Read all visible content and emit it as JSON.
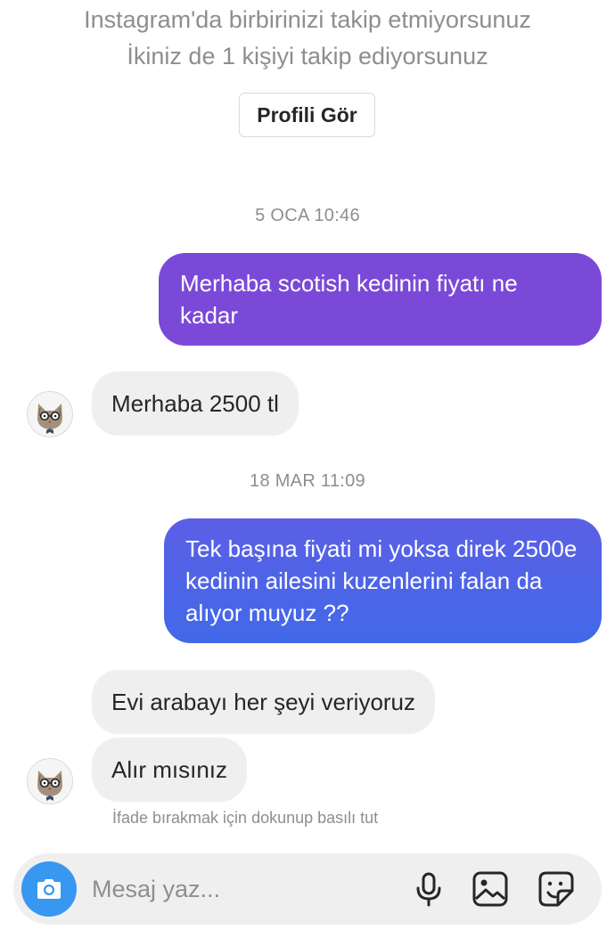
{
  "header": {
    "line1": "Instagram'da birbirinizi takip etmiyorsunuz",
    "line2": "İkiniz de 1 kişiyi takip ediyorsunuz",
    "view_profile_label": "Profili Gör"
  },
  "messages": {
    "timestamp_1": "5 OCA 10:46",
    "sent_1": "Merhaba  scotish kedinin fiyatı ne kadar",
    "received_1": "Merhaba 2500 tl",
    "timestamp_2": "18 MAR 11:09",
    "sent_2": "Tek başına fiyati mi yoksa direk 2500e kedinin ailesini kuzenlerini falan da alıyor muyuz ??",
    "received_2": "Evi arabayı her şeyi veriyoruz",
    "received_3": "Alır mısınız",
    "reaction_hint": "İfade bırakmak için dokunup basılı tut"
  },
  "composer": {
    "placeholder": "Mesaj yaz...",
    "icons": [
      "camera-icon",
      "microphone-icon",
      "image-icon",
      "sticker-icon"
    ]
  },
  "colors": {
    "sent_bubble_1": "#7b49d8",
    "sent_bubble_2_start": "#5b5fe6",
    "sent_bubble_2_end": "#4169e8",
    "received_bubble": "#efefef",
    "camera_button": "#3897f0"
  }
}
